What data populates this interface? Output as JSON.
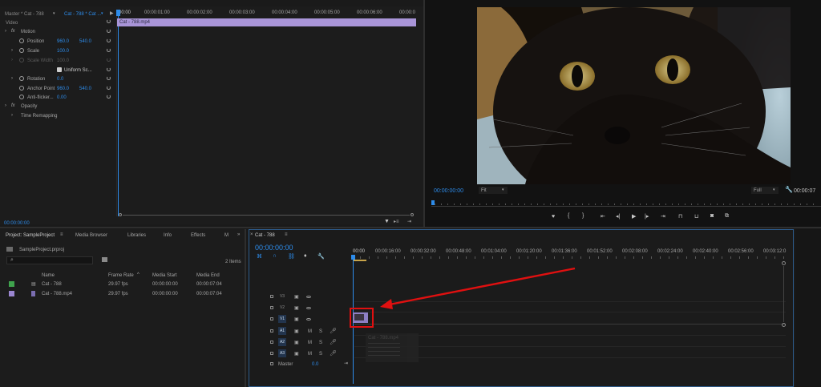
{
  "effect_controls": {
    "source_tab": "Master * Cat - 788",
    "clip_tab": "Cat - 788 * Cat ...",
    "section_video": "Video",
    "motion": "Motion",
    "position_label": "Position",
    "position_x": "960.0",
    "position_y": "540.0",
    "scale_label": "Scale",
    "scale_value": "100.0",
    "scale_width_label": "Scale Width",
    "scale_width_value": "100.0",
    "uniform_scale_label": "Uniform Sc...",
    "rotation_label": "Rotation",
    "rotation_value": "0.0",
    "anchor_label": "Anchor Point",
    "anchor_x": "960.0",
    "anchor_y": "540.0",
    "antiflicker_label": "Anti-flicker...",
    "antiflicker_value": "0.00",
    "opacity": "Opacity",
    "time_remapping": "Time Remapping",
    "timecode": "00:00:00:00",
    "mini_ruler": [
      "00:00",
      "00:00:01:00",
      "00:00:02:00",
      "00:00:03:00",
      "00:00:04:00",
      "00:00:05:00",
      "00:00:06:00",
      "00:00:0"
    ],
    "clip_label": "Cat - 788.mp4"
  },
  "program_monitor": {
    "timecode": "00:00:00:00",
    "fit": "Fit",
    "quality": "Full",
    "duration": "00:00:07"
  },
  "project": {
    "tabs": [
      "Project: SampleProject",
      "Media Browser",
      "Libraries",
      "Info",
      "Effects",
      "M"
    ],
    "file": "SampleProject.prproj",
    "search_placeholder": "",
    "items_count": "2 Items",
    "columns": [
      "Name",
      "Frame Rate",
      "Media Start",
      "Media End"
    ],
    "rows": [
      {
        "name": "Cat - 788",
        "frame_rate": "29.97 fps",
        "start": "00:00:00:00",
        "end": "00:00:07:04",
        "color": "#3fa34d"
      },
      {
        "name": "Cat - 788.mp4",
        "frame_rate": "29.97 fps",
        "start": "00:00:00:00",
        "end": "00:00:07:04",
        "color": "#9a86d0"
      }
    ]
  },
  "timeline": {
    "tab": "Cat - 788",
    "timecode": "00:00:00:00",
    "ruler": [
      "00:00",
      "00:00:16:00",
      "00:00:32:00",
      "00:00:48:00",
      "00:01:04:00",
      "00:01:20:00",
      "00:01:36:00",
      "00:01:52:00",
      "00:02:08:00",
      "00:02:24:00",
      "00:02:40:00",
      "00:02:56:00",
      "00:03:12:0"
    ],
    "video_tracks": [
      "V3",
      "V2",
      "V1"
    ],
    "audio_tracks": [
      "A1",
      "A2",
      "A3"
    ],
    "master_label": "Master",
    "master_value": "0.0",
    "mute": "M",
    "solo": "S",
    "clip_tooltip": "Cat - 788.mp4",
    "annotation_color": "#e01010"
  }
}
